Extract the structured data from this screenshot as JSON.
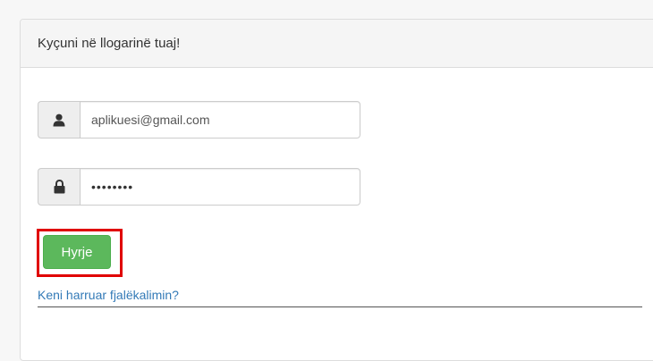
{
  "panel": {
    "title": "Kyçuni në llogarinë tuaj!"
  },
  "form": {
    "username": {
      "icon": "user-icon",
      "value": "aplikuesi@gmail.com"
    },
    "password": {
      "icon": "lock-icon",
      "value": "••••••••"
    },
    "submit_label": "Hyrje",
    "forgot_label": "Keni harruar fjalëkalimin?"
  },
  "colors": {
    "primary_button": "#5cb85c",
    "link": "#337ab7",
    "highlight": "#e00000"
  }
}
